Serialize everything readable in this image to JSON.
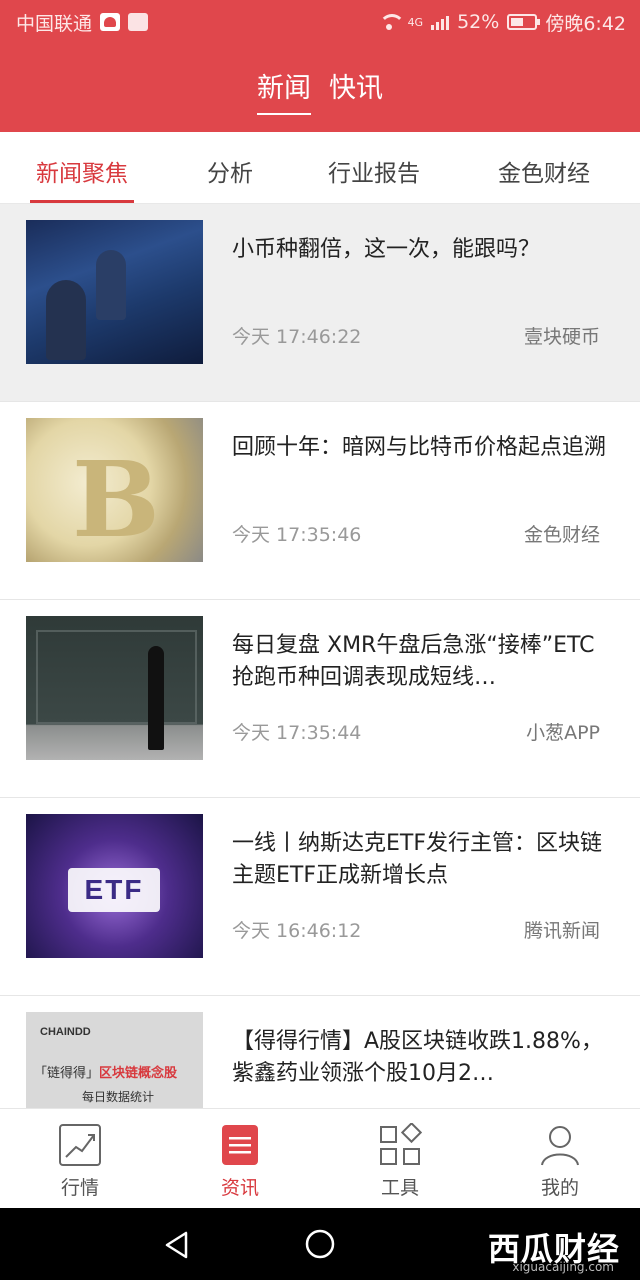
{
  "status_bar": {
    "carrier": "中国联通",
    "network": "4G",
    "battery": "52%",
    "time": "傍晚6:42"
  },
  "top_tabs": [
    {
      "label": "新闻",
      "active": true
    },
    {
      "label": "快讯",
      "active": false
    }
  ],
  "sub_tabs": [
    {
      "label": "新闻聚焦",
      "active": true
    },
    {
      "label": "分析",
      "active": false
    },
    {
      "label": "行业报告",
      "active": false
    },
    {
      "label": "金色财经",
      "active": false
    }
  ],
  "news": [
    {
      "title": "小币种翻倍，这一次，能跟吗？",
      "time": "今天 17:46:22",
      "source": "壹块硬币"
    },
    {
      "title": "回顾十年：暗网与比特币价格起点追溯",
      "time": "今天 17:35:46",
      "source": "金色财经"
    },
    {
      "title": "每日复盘  XMR午盘后急涨“接棒”ETC 抢跑币种回调表现成短线…",
      "time": "今天 17:35:44",
      "source": "小葱APP"
    },
    {
      "title": "一线丨纳斯达克ETF发行主管：区块链主题ETF正成新增长点",
      "time": "今天 16:46:12",
      "source": "腾讯新闻"
    },
    {
      "title": "【得得行情】A股区块链收跌1.88%，紫鑫药业领涨个股10月2…",
      "time": "",
      "source": ""
    }
  ],
  "thumb_text": {
    "etf": "ETF",
    "chaindd_logo": "CHAINDD",
    "chaindd_quote": "「链得得」",
    "chaindd_highlight": "区块链概念股",
    "chaindd_sub": "每日数据统计"
  },
  "bottom_nav": [
    {
      "label": "行情",
      "icon": "chart-trend-icon",
      "active": false
    },
    {
      "label": "资讯",
      "icon": "news-list-icon",
      "active": true
    },
    {
      "label": "工具",
      "icon": "tools-grid-icon",
      "active": false
    },
    {
      "label": "我的",
      "icon": "user-profile-icon",
      "active": false
    }
  ],
  "watermark": {
    "name": "西瓜财经",
    "url": "xiguacaijing.com"
  },
  "colors": {
    "brand_red": "#e0474c",
    "accent_red": "#d8393e"
  }
}
